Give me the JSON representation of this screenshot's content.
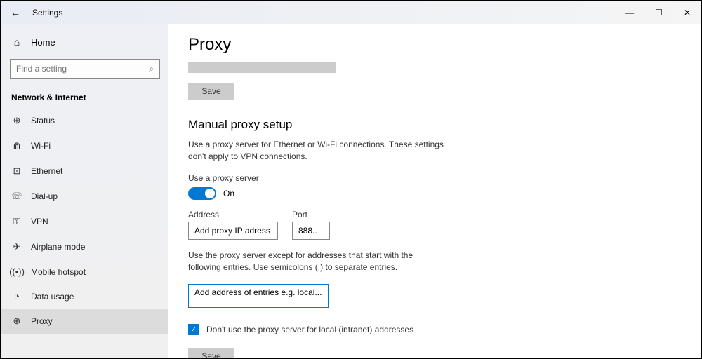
{
  "titlebar": {
    "title": "Settings"
  },
  "sidebar": {
    "home": "Home",
    "search_placeholder": "Find a setting",
    "category": "Network & Internet",
    "items": [
      {
        "label": "Status"
      },
      {
        "label": "Wi-Fi"
      },
      {
        "label": "Ethernet"
      },
      {
        "label": "Dial-up"
      },
      {
        "label": "VPN"
      },
      {
        "label": "Airplane mode"
      },
      {
        "label": "Mobile hotspot"
      },
      {
        "label": "Data usage"
      },
      {
        "label": "Proxy"
      }
    ]
  },
  "main": {
    "heading": "Proxy",
    "save1": "Save",
    "section_heading": "Manual proxy setup",
    "section_desc": "Use a proxy server for Ethernet or Wi-Fi connections. These settings don't apply to VPN connections.",
    "use_proxy_label": "Use a proxy server",
    "toggle_state": "On",
    "address_label": "Address",
    "address_value": "Add proxy IP adress",
    "port_label": "Port",
    "port_value": "888..",
    "exceptions_desc": "Use the proxy server except for addresses that start with the following entries. Use semicolons (;) to separate entries.",
    "exceptions_value": "Add address of entries e.g. local...",
    "local_bypass_label": "Don't use the proxy server for local (intranet) addresses",
    "save2": "Save"
  }
}
